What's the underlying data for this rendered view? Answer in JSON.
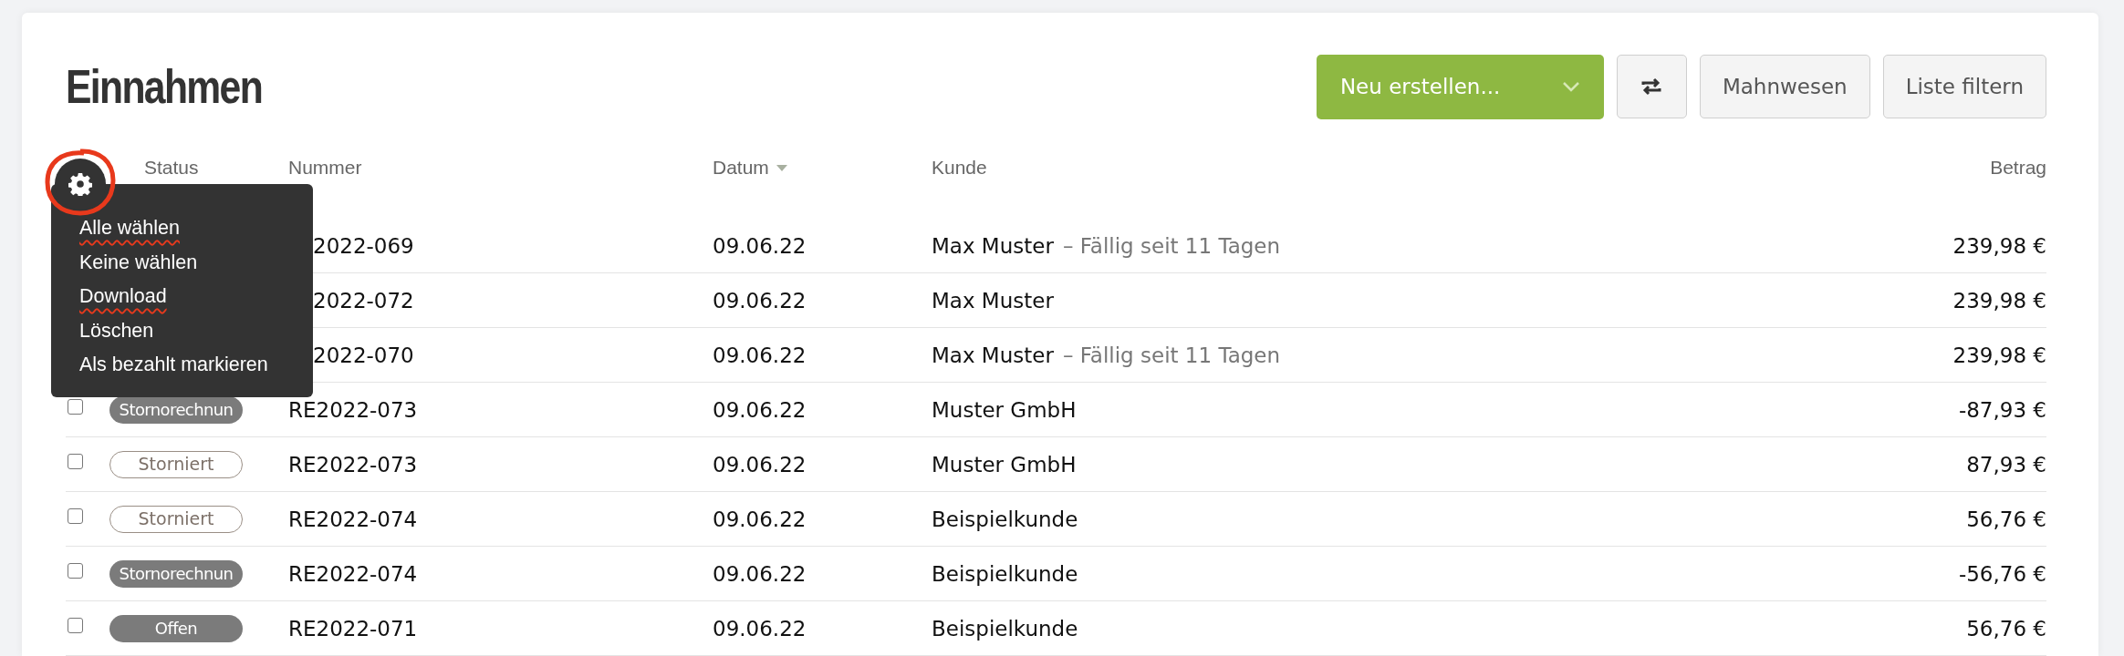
{
  "title": "Einnahmen",
  "toolbar": {
    "create_button": "Neu erstellen...",
    "buttons": [
      "Mahnwesen",
      "Liste filtern"
    ]
  },
  "columns": [
    {
      "label": "Status",
      "sorted": false
    },
    {
      "label": "Nummer",
      "sorted": false
    },
    {
      "label": "Datum",
      "sorted": true
    },
    {
      "label": "Kunde",
      "sorted": false
    },
    {
      "label": "Betrag",
      "sorted": false
    }
  ],
  "settings": {
    "circled": true
  },
  "menu": [
    {
      "label": "Alle wählen",
      "underlined": true
    },
    {
      "label": "Keine wählen",
      "underlined": false
    },
    {
      "label": "Download",
      "underlined": true
    },
    {
      "label": "Löschen",
      "underlined": false
    },
    {
      "label": "Als bezahlt markieren",
      "underlined": false
    }
  ],
  "rows": [
    {
      "number": "2022-069",
      "date": "09.06.22",
      "customer": "Max Muster",
      "note": "– Fällig seit 11 Tagen",
      "amount": "239,98 €"
    },
    {
      "number": "2022-072",
      "date": "09.06.22",
      "customer": "Max Muster",
      "amount": "239,98 €"
    },
    {
      "number": "2022-070",
      "date": "09.06.22",
      "customer": "Max Muster",
      "note": "– Fällig seit 11 Tagen",
      "amount": "239,98 €"
    },
    {
      "checked": false,
      "status": {
        "label": "Stornorechnun",
        "kind": "filled"
      },
      "number": "RE2022-073",
      "date": "09.06.22",
      "customer": "Muster GmbH",
      "amount": "-87,93 €"
    },
    {
      "checked": false,
      "status": {
        "label": "Storniert",
        "kind": "outline"
      },
      "number": "RE2022-073",
      "date": "09.06.22",
      "customer": "Muster GmbH",
      "amount": "87,93 €"
    },
    {
      "checked": false,
      "status": {
        "label": "Storniert",
        "kind": "outline"
      },
      "number": "RE2022-074",
      "date": "09.06.22",
      "customer": "Beispielkunde",
      "amount": "56,76 €"
    },
    {
      "checked": false,
      "status": {
        "label": "Stornorechnun",
        "kind": "filled"
      },
      "number": "RE2022-074",
      "date": "09.06.22",
      "customer": "Beispielkunde",
      "amount": "-56,76 €"
    },
    {
      "checked": false,
      "status": {
        "label": "Offen",
        "kind": "filled"
      },
      "number": "RE2022-071",
      "date": "09.06.22",
      "customer": "Beispielkunde",
      "amount": "56,76 €"
    }
  ]
}
